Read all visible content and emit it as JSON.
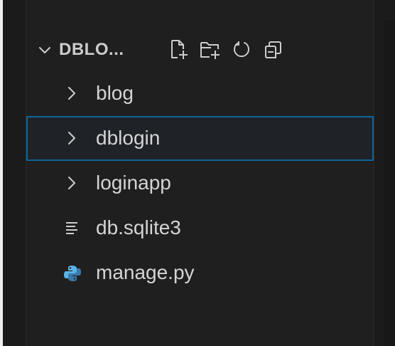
{
  "explorer": {
    "folder_title": "DBLO...",
    "actions": [
      {
        "name": "new-file-icon",
        "tooltip": "New File"
      },
      {
        "name": "new-folder-icon",
        "tooltip": "New Folder"
      },
      {
        "name": "refresh-icon",
        "tooltip": "Refresh Explorer"
      },
      {
        "name": "collapse-all-icon",
        "tooltip": "Collapse Folders in Explorer"
      }
    ],
    "items": [
      {
        "label": "blog",
        "type": "folder",
        "icon": "chevron-right-icon",
        "selected": false
      },
      {
        "label": "dblogin",
        "type": "folder",
        "icon": "chevron-right-icon",
        "selected": true
      },
      {
        "label": "loginapp",
        "type": "folder",
        "icon": "chevron-right-icon",
        "selected": false
      },
      {
        "label": "db.sqlite3",
        "type": "file",
        "icon": "lines-file-icon",
        "selected": false
      },
      {
        "label": "manage.py",
        "type": "file",
        "icon": "python-icon",
        "selected": false
      }
    ]
  },
  "colors": {
    "background": "#1f1f1f",
    "text": "#cccccc",
    "selection_border": "#0e639c",
    "python_blue": "#3c78aa",
    "python_cyan": "#5ab3e6"
  }
}
